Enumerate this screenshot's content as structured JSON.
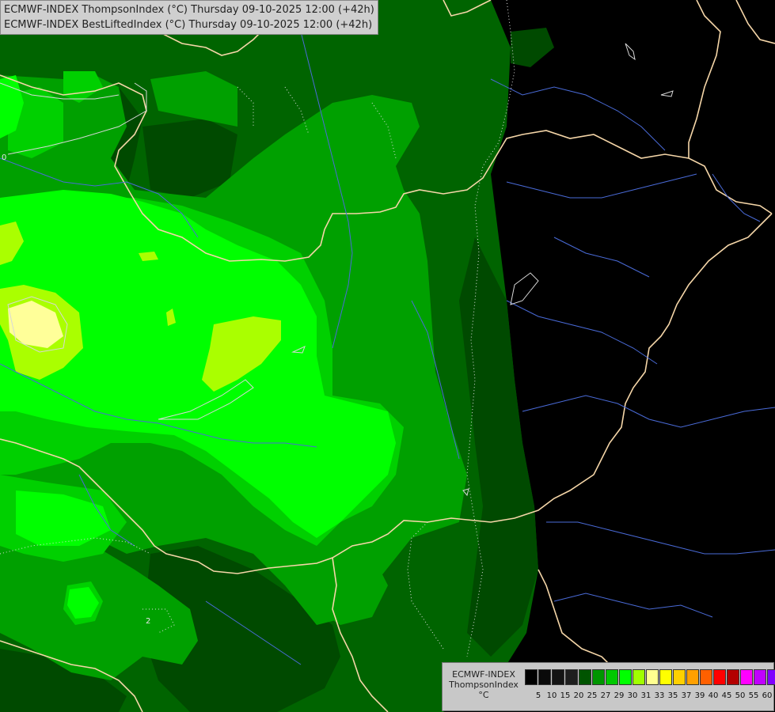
{
  "header": {
    "line1": "ECMWF-INDEX ThompsonIndex (°C) Thursday 09-10-2025 12:00 (+42h)",
    "line2": "ECMWF-INDEX BestLiftedIndex (°C) Thursday 09-10-2025 12:00 (+42h)"
  },
  "map": {
    "contour_labels": [
      "0",
      "2"
    ],
    "colors": {
      "background": "#000000",
      "level_15": "#004a00",
      "level_20": "#006400",
      "level_25": "#00a000",
      "level_27": "#00d000",
      "level_29": "#00ff00",
      "level_30": "#aaff00",
      "level_31": "#ffff99",
      "borders": "#f5d6a8",
      "rivers": "#4a6bd8"
    }
  },
  "legend": {
    "title_line1": "ECMWF-INDEX",
    "title_line2": "ThompsonIndex",
    "title_line3": "°C",
    "colors": [
      "#000000",
      "#0a0a0a",
      "#141414",
      "#1e1e1e",
      "#005400",
      "#009600",
      "#00c800",
      "#00ff00",
      "#a0ff00",
      "#ffff90",
      "#ffff00",
      "#ffd000",
      "#ffa000",
      "#ff6000",
      "#ff0000",
      "#b40000",
      "#ff00ff",
      "#c000ff",
      "#8000ff",
      "#4000ff",
      "#0000ff"
    ],
    "labels": [
      "5",
      "10",
      "15",
      "20",
      "25",
      "27",
      "29",
      "30",
      "31",
      "33",
      "35",
      "37",
      "39",
      "40",
      "45",
      "50",
      "55",
      "60"
    ]
  }
}
